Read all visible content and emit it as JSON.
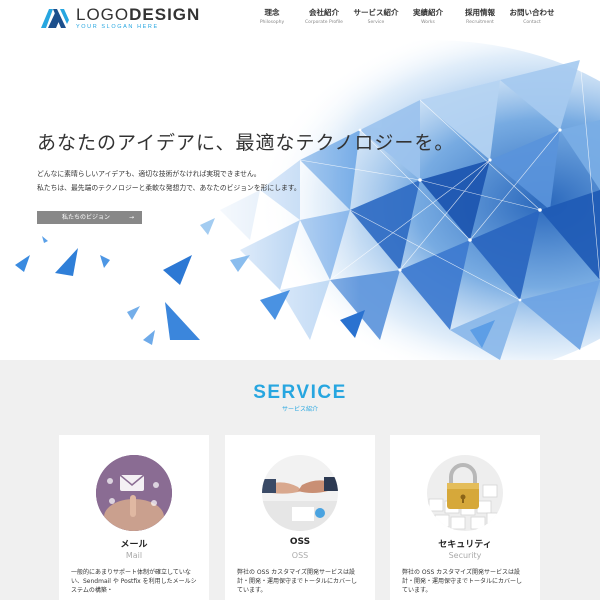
{
  "header": {
    "logo_name_thin": "LOGO",
    "logo_name_bold": "DESIGN",
    "logo_slogan": "YOUR SLOGAN HERE",
    "logo_icon": "logo-mark-icon",
    "nav": [
      {
        "jp": "理念",
        "en": "Philosophy"
      },
      {
        "jp": "会社紹介",
        "en": "Corporate Profile"
      },
      {
        "jp": "サービス紹介",
        "en": "Service"
      },
      {
        "jp": "実績紹介",
        "en": "Works"
      },
      {
        "jp": "採用情報",
        "en": "Recruitment"
      },
      {
        "jp": "お問い合わせ",
        "en": "Contact"
      }
    ]
  },
  "hero": {
    "headline": "あなたのアイデアに、最適なテクノロジーを。",
    "text_line1": "どんなに素晴らしいアイデアも、適切な技術がなければ実現できません。",
    "text_line2": "私たちは、最先端のテクノロジーと柔軟な発想力で、あなたのビジョンを形にします。",
    "button_label": "私たちのビジョン",
    "button_arrow": "→"
  },
  "service": {
    "title": "SERVICE",
    "subtitle": "サービス紹介",
    "cards": [
      {
        "title": "メール",
        "en": "Mail",
        "image_icon": "email-hand-image",
        "desc": [
          "一般的にあまりサポート体制が確立していな",
          "い、Sendmail や Postfix を利用したメールシ",
          "ステムの構築・"
        ]
      },
      {
        "title": "OSS",
        "en": "OSS",
        "image_icon": "handshake-image",
        "desc": [
          "弊社の OSS カスタマイズ開発サービスは設",
          "計・開発・運用保守までトータルにカバーし",
          "ています。"
        ]
      },
      {
        "title": "セキュリティ",
        "en": "Security",
        "image_icon": "padlock-keyboard-image",
        "desc": [
          "弊社の OSS カスタマイズ開発サービスは設",
          "計・開発・運用保守までトータルにカバーし",
          "ています。"
        ]
      }
    ]
  },
  "colors": {
    "accent": "#27a6e0",
    "button_bg": "#888888",
    "section_bg": "#f0f0f0"
  }
}
